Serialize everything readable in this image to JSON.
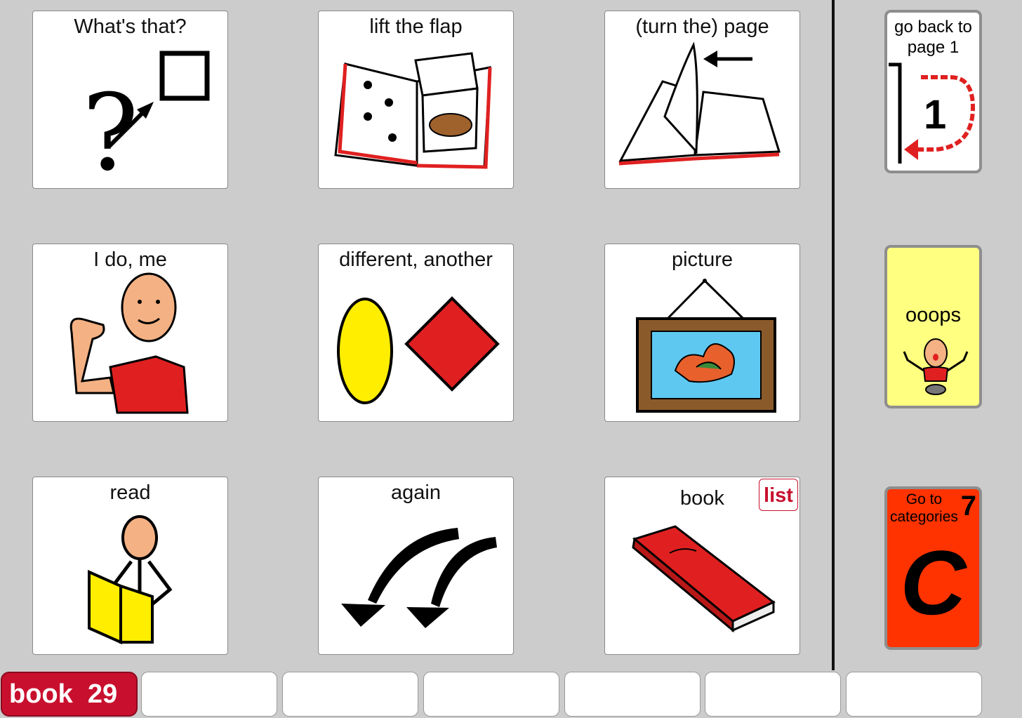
{
  "grid": {
    "cells": [
      {
        "label": "What's that?"
      },
      {
        "label": "lift the flap"
      },
      {
        "label": "(turn the) page"
      },
      {
        "label": "I do, me"
      },
      {
        "label": "different,  another"
      },
      {
        "label": "picture"
      },
      {
        "label": "read"
      },
      {
        "label": "again"
      },
      {
        "label": "book",
        "badge": "list"
      }
    ]
  },
  "sidebar": {
    "back": {
      "label_line1": "go back to",
      "label_line2": "page 1",
      "number": "1"
    },
    "oops": {
      "label": "ooops"
    },
    "categories": {
      "label_line1": "Go to",
      "label_line2": "categories",
      "number": "7",
      "letter": "C"
    }
  },
  "footer": {
    "page_name": "book",
    "page_number": "29"
  },
  "colors": {
    "accent": "#c8102e",
    "oops_bg": "#ffff80",
    "categories_bg": "#ff3300",
    "background": "#cccccc"
  }
}
